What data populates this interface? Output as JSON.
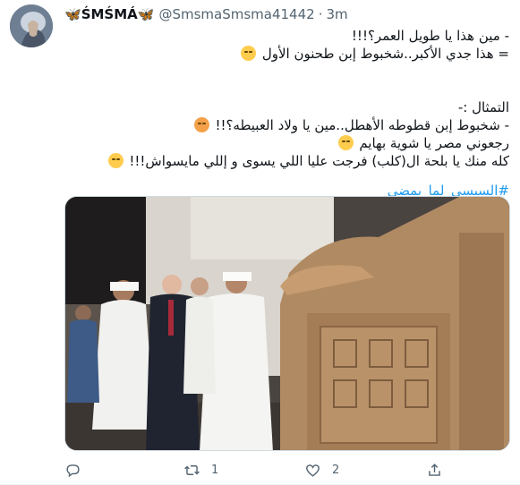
{
  "tweet": {
    "display_name": "ŚMŚMÁ",
    "display_name_decoration": "butterfly-emoji",
    "handle": "@SmsmaSmsma41442",
    "separator": "·",
    "time": "3m",
    "lines": [
      "- مين هذا يا طويل العمر؟!!!",
      "= هذا جدي الأكبر..شخبوط إبن طحنون الأول",
      "",
      "التمثال :-",
      "- شخبوط إبن قطوطه الأهطل..مين يا ولاد العبيطه؟!!",
      "رجعوني مصر يا شوية بهايم",
      "كله منك يا بلحة ال(كلب) فرجت عليا اللي يسوى و إللي مايسواش!!!"
    ],
    "hashtag": "#السيسى_لما_يمضى"
  },
  "actions": {
    "reply_count": "",
    "retweet_count": "1",
    "like_count": "2"
  },
  "colors": {
    "link": "#1d9bf0",
    "secondary_text": "#536471",
    "primary_text": "#0f1419"
  },
  "icons": {
    "reply": "speech-bubble-icon",
    "retweet": "retweet-arrows-icon",
    "like": "heart-icon",
    "share": "share-upload-icon"
  }
}
